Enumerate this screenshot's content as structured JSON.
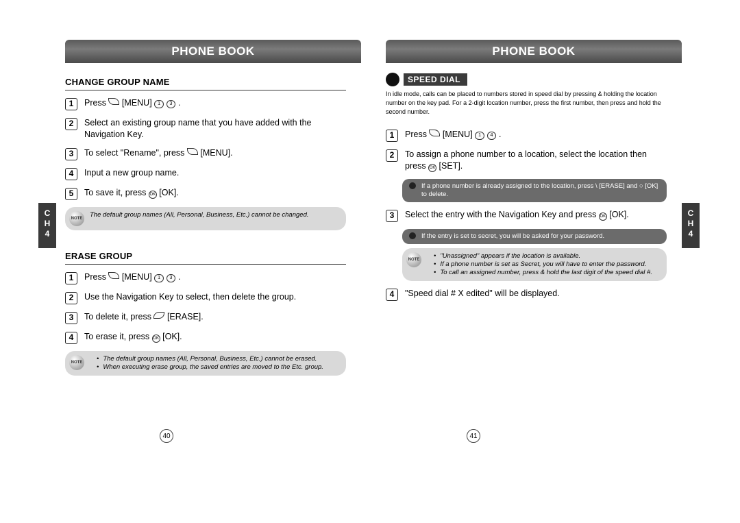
{
  "chapter": {
    "label_line1": "C",
    "label_line2": "H",
    "number": "4"
  },
  "left_page": {
    "header": "PHONE BOOK",
    "section1": {
      "title": "CHANGE GROUP NAME",
      "steps": {
        "s1": {
          "n": "1",
          "pre": "Press ",
          "post": " [MENU] ",
          "keys": "1▯ 3▯",
          "end": "."
        },
        "s2": {
          "n": "2",
          "text": "Select an existing group name that you have added with the Navigation Key."
        },
        "s3": {
          "n": "3",
          "pre": "To select \"Rename\", press ",
          "post": " [MENU]."
        },
        "s4": {
          "n": "4",
          "text": "Input a new group name."
        },
        "s5": {
          "n": "5",
          "pre": "To save it, press ",
          "post": " [OK]."
        }
      },
      "note": "The default group names (All, Personal, Business, Etc.) cannot be changed."
    },
    "section2": {
      "title": "ERASE GROUP",
      "steps": {
        "s1": {
          "n": "1",
          "pre": "Press ",
          "post": " [MENU] ",
          "keys": "1▯ 3▯",
          "end": "."
        },
        "s2": {
          "n": "2",
          "text": "Use the Navigation Key to select, then delete the group."
        },
        "s3": {
          "n": "3",
          "pre": "To delete it, press ",
          "post": " [ERASE]."
        },
        "s4": {
          "n": "4",
          "pre": "To erase it, press ",
          "post": " [OK]."
        }
      },
      "note": {
        "b1": "The default group names (All, Personal, Business, Etc.) cannot be erased.",
        "b2": "When executing erase group, the saved entries are moved to the Etc. group."
      }
    },
    "page_number": "40"
  },
  "right_page": {
    "header": "PHONE BOOK",
    "speed_dial": {
      "label": "SPEED DIAL",
      "intro": "In idle mode, calls can be placed to numbers stored in speed dial by pressing & holding the location number on the key pad. For a 2-digit location number, press the first number, then press and hold the second number.",
      "steps": {
        "s1": {
          "n": "1",
          "pre": "Press ",
          "post": " [MENU] ",
          "keys": "1▯ 4▯",
          "end": "."
        },
        "s2": {
          "n": "2",
          "pre": "To assign a phone number to a location, select the location then press ",
          "post": " [SET]."
        },
        "dark1": "If a phone number is already assigned to the location, press \\ [ERASE] and ○ [OK] to delete.",
        "s3": {
          "n": "3",
          "pre": "Select the entry with the Navigation Key and press ",
          "post": " [OK]."
        },
        "dark2": "If the entry is set to secret, you will be asked for your password.",
        "note": {
          "b1": "\"Unassigned\" appears if the location is available.",
          "b2": "If a phone number is set as Secret, you will have to enter the password.",
          "b3": "To call an assigned number, press & hold the last digit of the speed dial #."
        },
        "s4": {
          "n": "4",
          "text": "\"Speed dial # X edited\" will be displayed."
        }
      }
    },
    "page_number": "41"
  },
  "icons": {
    "note_label": "NOTE"
  }
}
